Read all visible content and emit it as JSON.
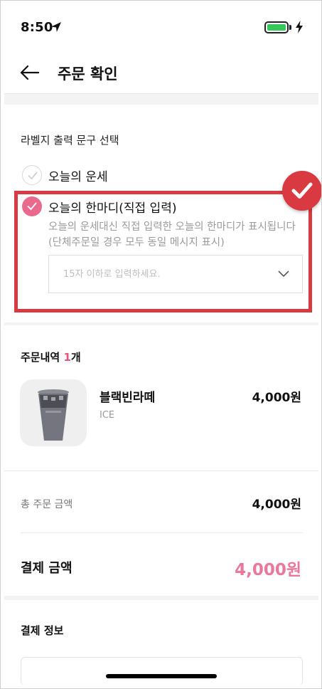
{
  "status_bar": {
    "time": "8:50",
    "battery_color": "#35c759"
  },
  "header": {
    "title": "주문 확인",
    "back_icon": "arrow-left-icon"
  },
  "label_section": {
    "title": "라벨지 출력 문구 선택",
    "options": [
      {
        "label": "오늘의 운세",
        "selected": false
      },
      {
        "label": "오늘의 한마디(직접 입력)",
        "selected": true
      }
    ],
    "description_line1": "오늘의 운세대신 직접 입력한 오늘의 한마디가 표시됩니다",
    "description_line2": "(단체주문일 경우 모두 동일 메시지 표시)",
    "input": {
      "value": "",
      "placeholder": "15자 이하로 입력하세요."
    }
  },
  "order_section": {
    "title": "주문내역",
    "count": "1",
    "count_suffix": "개",
    "items": [
      {
        "name": "블랙빈라떼",
        "option": "ICE",
        "price": "4,000원"
      }
    ]
  },
  "summary": {
    "total_label": "총 주문 금액",
    "total_value": "4,000원",
    "pay_label": "결제 금액",
    "pay_value": "4,000원",
    "pay_color": "#e8799c"
  },
  "payment_info": {
    "title": "결제 정보"
  },
  "colors": {
    "accent_pink": "#ea6a8d",
    "highlight_red": "#d93a41"
  }
}
